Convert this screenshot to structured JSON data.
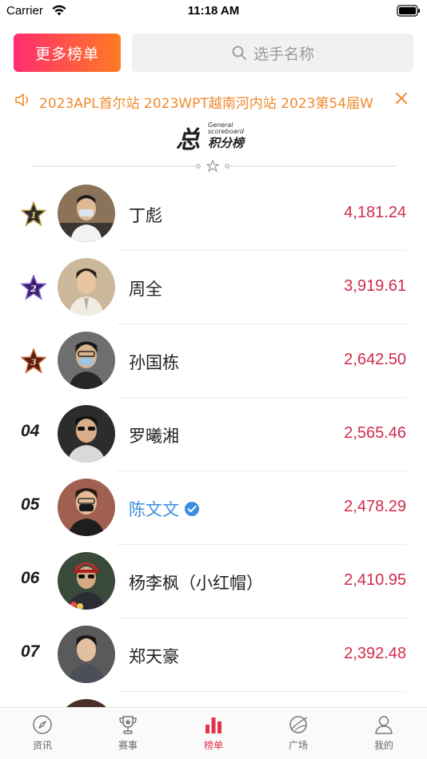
{
  "status_bar": {
    "carrier": "Carrier",
    "time": "11:18 AM"
  },
  "header": {
    "more_button": "更多榜单",
    "search_placeholder": "选手名称"
  },
  "marquee": {
    "text": "2023APL首尔站 2023WPT越南河内站 2023第54届W"
  },
  "board": {
    "title_big": "总",
    "title_en_1": "General",
    "title_en_2": "scoreboard",
    "title_cn": "积分榜"
  },
  "ranks": [
    {
      "rank": "1",
      "name": "丁彪",
      "score": "4,181.24",
      "medal": "gold"
    },
    {
      "rank": "2",
      "name": "周全",
      "score": "3,919.61",
      "medal": "purple"
    },
    {
      "rank": "3",
      "name": "孙国栋",
      "score": "2,642.50",
      "medal": "bronze"
    },
    {
      "rank": "04",
      "name": "罗曦湘",
      "score": "2,565.46"
    },
    {
      "rank": "05",
      "name": "陈文文",
      "score": "2,478.29",
      "verified": true
    },
    {
      "rank": "06",
      "name": "杨李枫（小红帽）",
      "score": "2,410.95"
    },
    {
      "rank": "07",
      "name": "郑天豪",
      "score": "2,392.48"
    }
  ],
  "tabbar": {
    "items": [
      {
        "label": "资讯",
        "icon": "compass-icon"
      },
      {
        "label": "赛事",
        "icon": "trophy-icon"
      },
      {
        "label": "榜单",
        "icon": "bar-chart-icon",
        "active": true
      },
      {
        "label": "广场",
        "icon": "plaza-icon"
      },
      {
        "label": "我的",
        "icon": "user-icon"
      }
    ]
  },
  "colors": {
    "accent": "#e5324b",
    "score": "#d12b4c",
    "marquee": "#f08a2c",
    "verified": "#3b8fdc"
  }
}
